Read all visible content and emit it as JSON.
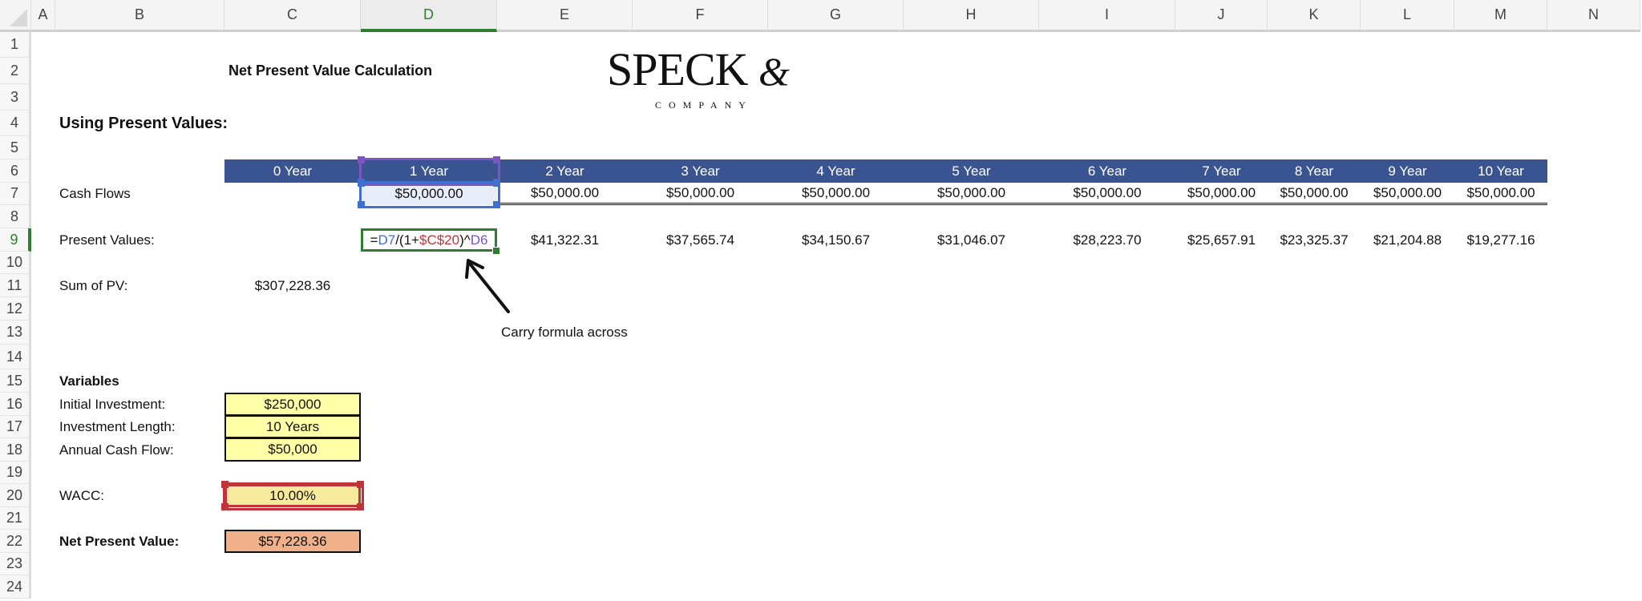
{
  "columns": [
    "A",
    "B",
    "C",
    "D",
    "E",
    "F",
    "G",
    "H",
    "I",
    "J",
    "K",
    "L",
    "M",
    "N"
  ],
  "selected_column": "D",
  "rows": [
    "1",
    "2",
    "3",
    "4",
    "5",
    "6",
    "7",
    "8",
    "9",
    "10",
    "11",
    "12",
    "13",
    "14",
    "15",
    "16",
    "17",
    "18",
    "19",
    "20",
    "21",
    "22",
    "23",
    "24"
  ],
  "selected_row": "9",
  "title": "Net Present Value Calculation",
  "logo": {
    "main": "SPECK",
    "amp": "&",
    "sub": "COMPANY"
  },
  "section_heading": "Using Present Values:",
  "year_headers": [
    "0 Year",
    "1 Year",
    "2 Year",
    "3 Year",
    "4 Year",
    "5 Year",
    "6 Year",
    "7 Year",
    "8 Year",
    "9 Year",
    "10 Year"
  ],
  "cash_flows_label": "Cash Flows",
  "cash_flows": [
    "",
    "$50,000.00",
    "$50,000.00",
    "$50,000.00",
    "$50,000.00",
    "$50,000.00",
    "$50,000.00",
    "$50,000.00",
    "$50,000.00",
    "$50,000.00",
    "$50,000.00"
  ],
  "present_values_label": "Present Values:",
  "formula": {
    "p1": "=",
    "p2": "D7",
    "p3": "/(1+",
    "p4": "$C$20",
    "p5": ")^",
    "p6": "D6"
  },
  "present_values": [
    "$41,322.31",
    "$37,565.74",
    "$34,150.67",
    "$31,046.07",
    "$28,223.70",
    "$25,657.91",
    "$23,325.37",
    "$21,204.88",
    "$19,277.16"
  ],
  "sum_pv_label": "Sum of PV:",
  "sum_pv": "$307,228.36",
  "annotation": "Carry formula across",
  "variables": {
    "heading": "Variables",
    "items": [
      {
        "label": "Initial Investment:",
        "value": "$250,000"
      },
      {
        "label": "Investment Length:",
        "value": "10 Years"
      },
      {
        "label": "Annual Cash Flow:",
        "value": "$50,000"
      }
    ],
    "wacc_label": "WACC:",
    "wacc_value": "10.00%",
    "npv_label": "Net Present Value:",
    "npv_value": "$57,228.36"
  },
  "colors": {
    "header_blue": "#3a5491",
    "ref_blue": "#3f6fd0",
    "ref_red": "#c0333b",
    "ref_purple": "#7b55c0",
    "active_green": "#2e7d32",
    "input_yellow": "#ffffa8",
    "npv_orange": "#efb08a"
  }
}
